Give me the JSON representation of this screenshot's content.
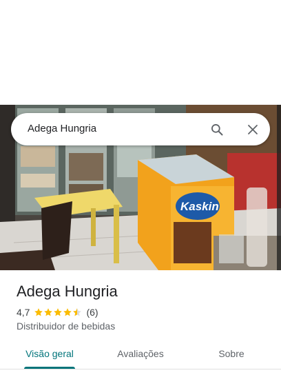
{
  "search": {
    "query": "Adega Hungria"
  },
  "photo": {
    "freezer_brand": "Kaskin"
  },
  "place": {
    "name": "Adega Hungria",
    "rating": "4,7",
    "review_count": "(6)",
    "stars_filled": 4.5,
    "category": "Distribuidor de bebidas"
  },
  "tabs": [
    {
      "label": "Visão geral",
      "active": true
    },
    {
      "label": "Avaliações",
      "active": false
    },
    {
      "label": "Sobre",
      "active": false
    }
  ],
  "colors": {
    "accent": "#00747a",
    "star": "#fbbc04"
  },
  "icons": [
    "search-icon",
    "close-icon",
    "star-icon"
  ]
}
